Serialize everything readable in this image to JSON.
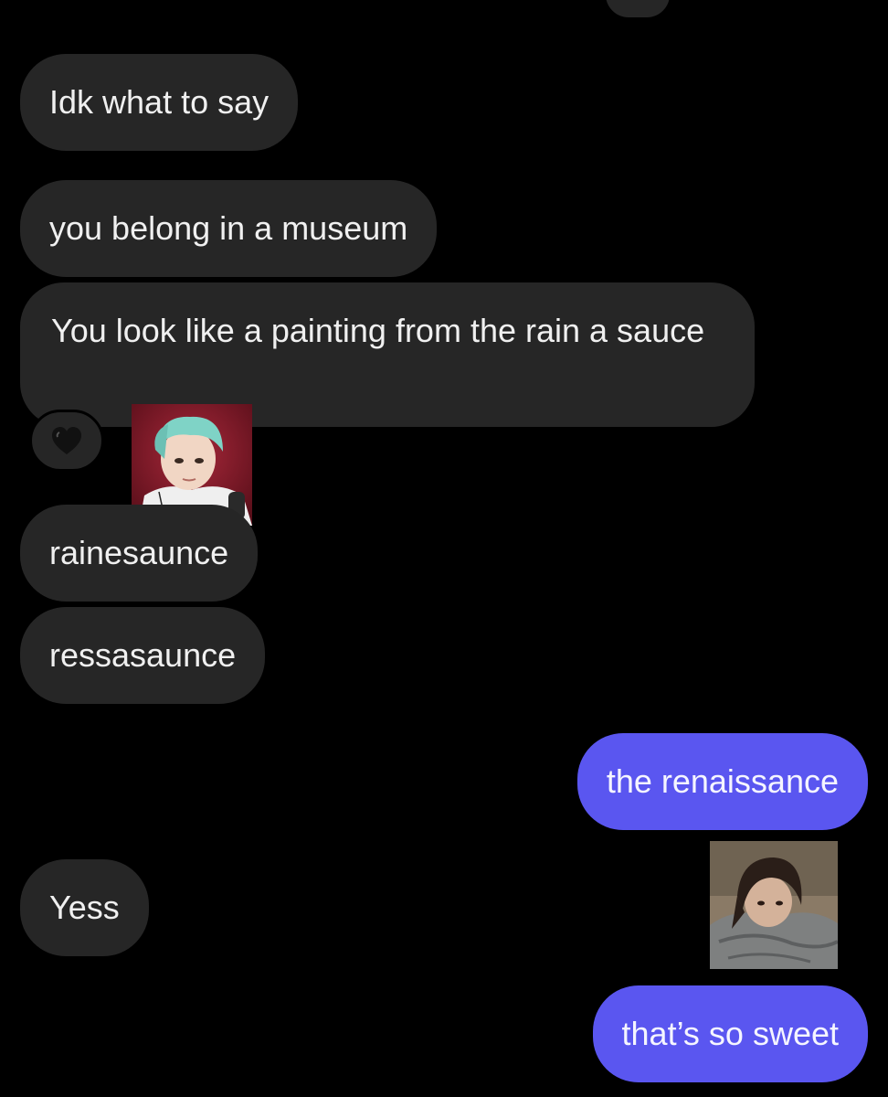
{
  "conversation": {
    "messages": [
      {
        "sender": "them",
        "text": "Idk what to say"
      },
      {
        "sender": "them",
        "text": "you belong in a museum"
      },
      {
        "sender": "them",
        "text": "You look like a painting from the rain a sauce"
      },
      {
        "sender": "them",
        "text": "rainesaunce"
      },
      {
        "sender": "them",
        "text": "ressasaunce"
      },
      {
        "sender": "me",
        "text": "the renaissance"
      },
      {
        "sender": "them",
        "text": "Yess"
      },
      {
        "sender": "me",
        "text": "that’s so sweet"
      }
    ],
    "reactions": {
      "top_partial": "red-heart-icon",
      "painting_message": "black-heart-icon"
    }
  },
  "colors": {
    "background": "#000000",
    "incoming_bubble": "#262626",
    "outgoing_bubble": "#5a56f0",
    "text": "#f2f2f2"
  },
  "avatars": {
    "them": "sender-avatar-teal-hair",
    "me": "receiver-avatar-dark-hair"
  }
}
